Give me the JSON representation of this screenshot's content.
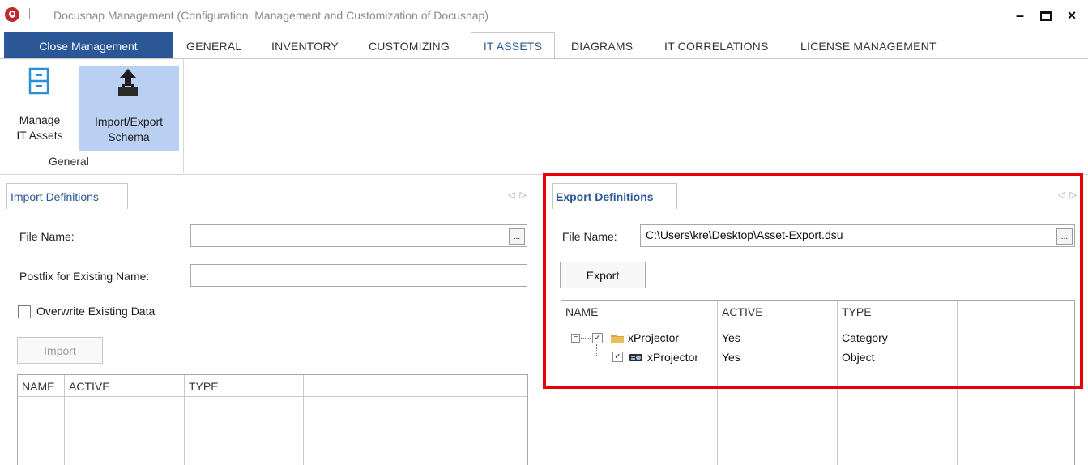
{
  "window": {
    "title": "Docusnap Management (Configuration, Management and Customization of Docusnap)",
    "minimize": "–",
    "maximize": "□",
    "close": "×"
  },
  "tabs": {
    "close_management": "Close Management",
    "items": [
      "GENERAL",
      "INVENTORY",
      "CUSTOMIZING",
      "IT ASSETS",
      "DIAGRAMS",
      "IT CORRELATIONS",
      "LICENSE MANAGEMENT"
    ],
    "active": "IT ASSETS"
  },
  "ribbon": {
    "manage_label_1": "Manage",
    "manage_label_2": "IT Assets",
    "import_export_label_1": "Import/Export",
    "import_export_label_2": "Schema",
    "group_label": "General"
  },
  "import_panel": {
    "tab_label": "Import Definitions",
    "file_name_label": "File Name:",
    "file_name_value": "",
    "postfix_label": "Postfix for Existing Name:",
    "postfix_value": "",
    "overwrite_label": "Overwrite Existing Data",
    "overwrite_checked": false,
    "import_button": "Import",
    "columns": [
      "NAME",
      "ACTIVE",
      "TYPE"
    ]
  },
  "export_panel": {
    "tab_label": "Export Definitions",
    "file_name_label": "File Name:",
    "file_name_value": "C:\\Users\\kre\\Desktop\\Asset-Export.dsu",
    "export_button": "Export",
    "columns": [
      "NAME",
      "ACTIVE",
      "TYPE"
    ],
    "rows": [
      {
        "name": "xProjector",
        "active": "Yes",
        "type": "Category",
        "checked": true,
        "icon": "folder-icon",
        "level": 0
      },
      {
        "name": "xProjector",
        "active": "Yes",
        "type": "Object",
        "checked": true,
        "icon": "projector-icon",
        "level": 1
      }
    ]
  },
  "browse_button": "..."
}
